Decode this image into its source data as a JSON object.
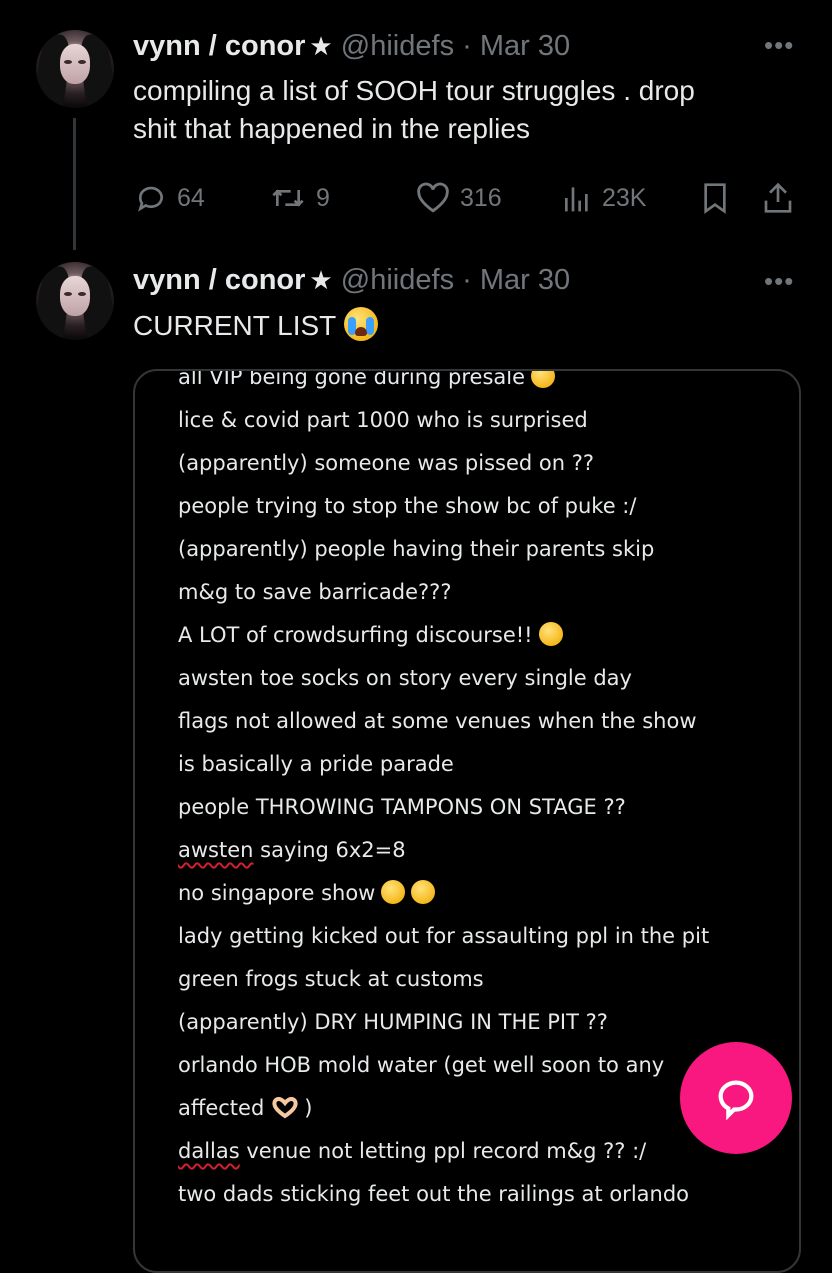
{
  "tweets": [
    {
      "name": "vynn / conor",
      "handle_time": "@hiidefs · Mar 30",
      "text_lines": [
        "compiling a list of SOOH tour struggles . drop",
        "shit that happened in the replies"
      ],
      "actions": {
        "replies": "64",
        "retweets": "9",
        "likes": "316",
        "views": "23K"
      }
    },
    {
      "name": "vynn / conor",
      "handle_time": "@hiidefs · Mar 30",
      "text": "CURRENT LIST"
    }
  ],
  "list_image": {
    "lines": [
      {
        "text": "all VIP being gone during presale",
        "emoji": "disappointed-face"
      },
      {
        "text": "lice & covid part 1000 who is surprised"
      },
      {
        "text": "(apparently) someone was pissed on ??"
      },
      {
        "text": "people trying to stop the show bc of puke :/"
      },
      {
        "text": "(apparently) people having their parents skip"
      },
      {
        "text": "m&g to save barricade???"
      },
      {
        "text": "A LOT of crowdsurfing discourse!!",
        "emoji": "frowning-face"
      },
      {
        "text": "awsten toe socks on story every single day"
      },
      {
        "text": "flags not allowed at some venues when the show"
      },
      {
        "text": "is basically a pride parade"
      },
      {
        "text": "people THROWING TAMPONS ON STAGE ??"
      },
      {
        "text_underlined": "awsten",
        "text": " saying 6x2=8"
      },
      {
        "text": "no singapore show",
        "emoji": "worried-faces"
      },
      {
        "text": "lady getting kicked out for assaulting ppl in the pit"
      },
      {
        "text": "green frogs stuck at customs"
      },
      {
        "text": "(apparently) DRY HUMPING IN THE PIT ??"
      },
      {
        "text": "orlando HOB mold water (get well soon to any"
      },
      {
        "text": "affected",
        "emoji": "heart-hands",
        "suffix": ")"
      },
      {
        "text_underlined": "dallas",
        "text": " venue not letting ppl record m&g ?? :/"
      },
      {
        "text": "two dads sticking feet out the railings at orlando"
      }
    ]
  },
  "colors": {
    "background": "#000000",
    "text": "#e7e9ea",
    "muted": "#71767b",
    "fab": "#f91880",
    "card_border": "#333639"
  },
  "icons": [
    "reply-icon",
    "retweet-icon",
    "like-icon",
    "views-icon",
    "bookmark-icon",
    "share-icon",
    "more-icon",
    "star-icon",
    "compose-reply-icon"
  ]
}
